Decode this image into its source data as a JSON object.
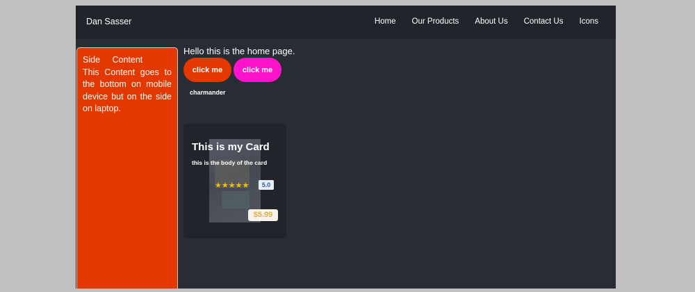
{
  "navbar": {
    "brand": "Dan Sasser",
    "links": [
      "Home",
      "Our Products",
      "About Us",
      "Contact Us",
      "Icons"
    ]
  },
  "side": {
    "title": "Side Content",
    "body": "This Content goes to the bottom on mobile device but on the side on laptop."
  },
  "main": {
    "greeting": "Hello this is the home page.",
    "buttons": [
      "click me",
      "click me"
    ],
    "pokemon": "charmander"
  },
  "card": {
    "title": "This is my Card",
    "body": "this is the body of the card",
    "stars": "★★★★★",
    "rating": "5.0",
    "rating_value": 5,
    "price": "$5.99"
  },
  "colors": {
    "background": "#282c34",
    "navbar": "#21252b",
    "side": "#e33800",
    "button1": "#e33800",
    "button2": "#ff14cc",
    "stars": "#f5c000"
  }
}
